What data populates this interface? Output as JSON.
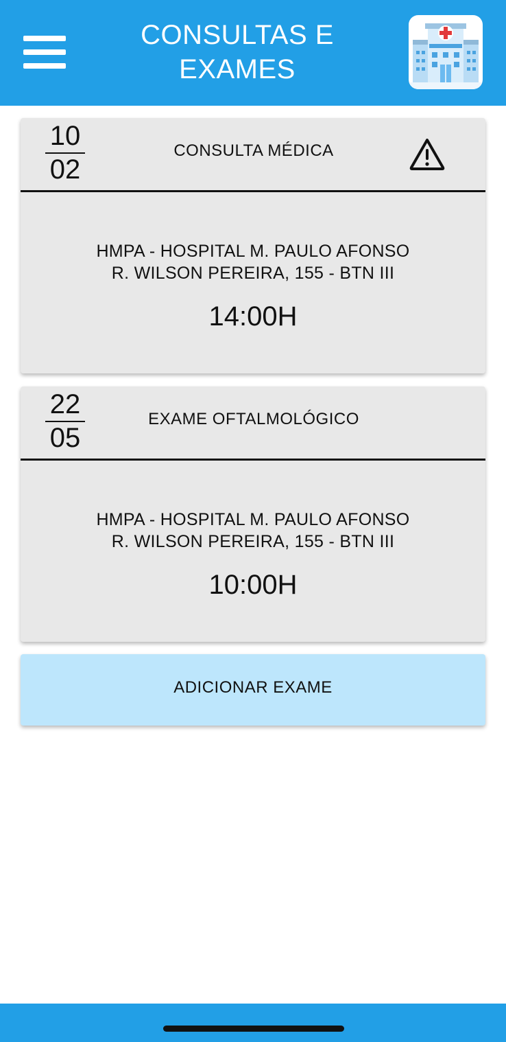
{
  "header": {
    "menu_icon": "hamburger-menu-icon",
    "title_line1": "CONSULTAS E",
    "title_line2": "EXAMES",
    "logo_icon": "hospital-building-icon",
    "color": "#229fe6"
  },
  "appointments": [
    {
      "day": "10",
      "month": "02",
      "type": "CONSULTA MÉDICA",
      "alert_icon": "warning-triangle-icon",
      "place": "HMPA - HOSPITAL M. PAULO AFONSO",
      "address": "R. WILSON PEREIRA, 155 - BTN III",
      "time": "14:00H"
    },
    {
      "day": "22",
      "month": "05",
      "type": "EXAME OFTALMOLÓGICO",
      "place": "HMPA - HOSPITAL M. PAULO AFONSO",
      "address": "R. WILSON PEREIRA, 155 - BTN III",
      "time": "10:00H"
    }
  ],
  "add_button": {
    "label": "ADICIONAR EXAME",
    "color": "#bde6fc"
  },
  "colors": {
    "card_background": "#e8e8e8",
    "bottom_bar": "#229fe6"
  }
}
